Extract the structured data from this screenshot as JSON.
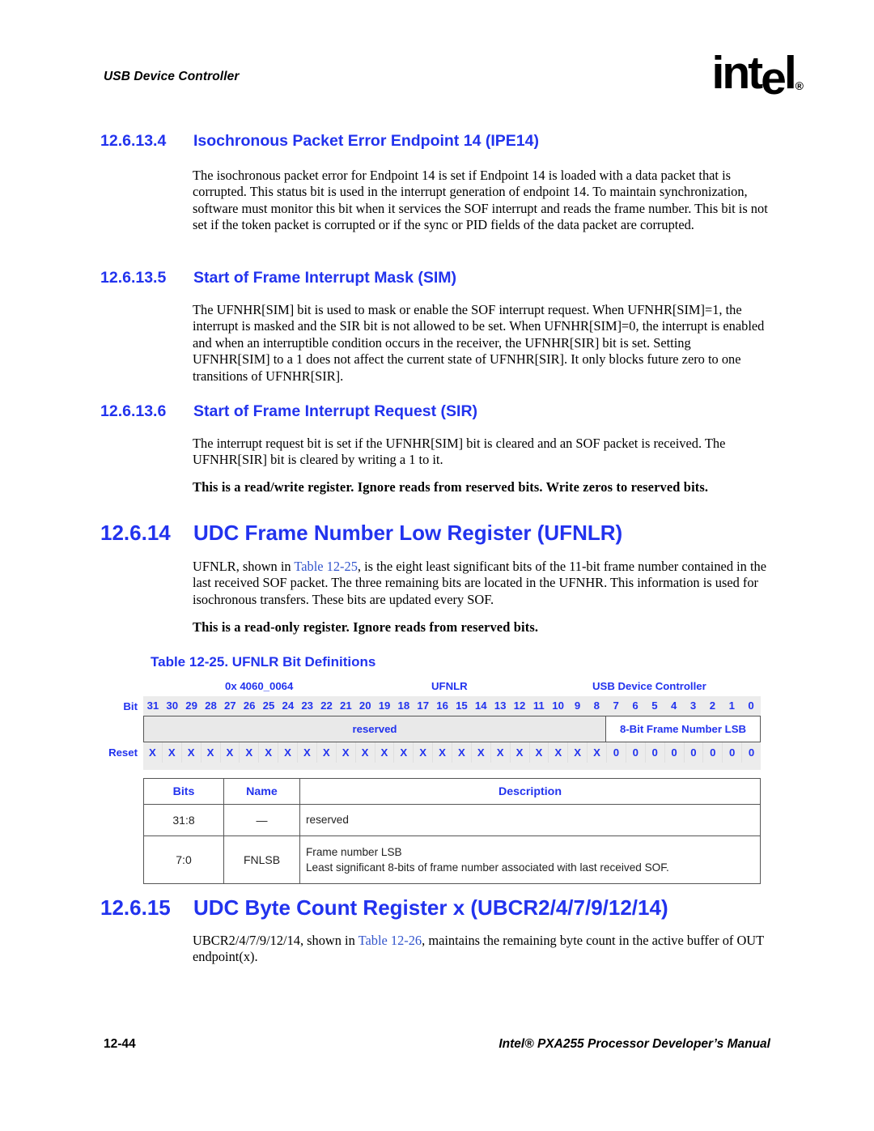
{
  "header": {
    "running_title": "USB Device Controller",
    "logo_text": "intel",
    "logo_registered": "®"
  },
  "sections": [
    {
      "number": "12.6.13.4",
      "title": "Isochronous Packet Error Endpoint 14 (IPE14)",
      "paragraph": "The isochronous packet error for Endpoint 14 is set if Endpoint 14 is loaded with a data packet that is corrupted. This status bit is used in the interrupt generation of endpoint 14. To maintain synchronization, software must monitor this bit when it services the SOF interrupt and reads the frame number. This bit is not set if the token packet is corrupted or if the sync or PID fields of the data packet are corrupted."
    },
    {
      "number": "12.6.13.5",
      "title": "Start of Frame Interrupt Mask (SIM)",
      "paragraph": "The UFNHR[SIM] bit is used to mask or enable the SOF interrupt request. When UFNHR[SIM]=1, the interrupt is masked and the SIR bit is not allowed to be set. When UFNHR[SIM]=0, the interrupt is enabled and when an interruptible condition occurs in the receiver, the UFNHR[SIR] bit is set. Setting UFNHR[SIM] to a 1 does not affect the current state of UFNHR[SIR]. It only blocks future zero to one transitions of UFNHR[SIR]."
    },
    {
      "number": "12.6.13.6",
      "title": "Start of Frame Interrupt Request (SIR)",
      "paragraph": "The interrupt request bit is set if the UFNHR[SIM] bit is cleared and an SOF packet is received. The UFNHR[SIR] bit is cleared by writing a 1 to it.",
      "note": "This is a read/write register. Ignore reads from reserved bits. Write zeros to reserved bits."
    }
  ],
  "ufnlr_section": {
    "number": "12.6.14",
    "title": "UDC Frame Number Low Register (UFNLR)",
    "para_pre": "UFNLR, shown in ",
    "para_xref": "Table 12-25",
    "para_post": ", is the eight least significant bits of the 11-bit frame number contained in the last received SOF packet. The three remaining bits are located in the UFNHR. This information is used for isochronous transfers. These bits are updated every SOF.",
    "note": "This is a read-only register. Ignore reads from reserved bits.",
    "table_caption": "Table 12-25. UFNLR Bit Definitions"
  },
  "register_diagram": {
    "address": "0x 4060_0064",
    "register_name": "UFNLR",
    "unit": "USB Device Controller",
    "bit_row_label": "Bit",
    "reset_row_label": "Reset",
    "bit_numbers": [
      "31",
      "30",
      "29",
      "28",
      "27",
      "26",
      "25",
      "24",
      "23",
      "22",
      "21",
      "20",
      "19",
      "18",
      "17",
      "16",
      "15",
      "14",
      "13",
      "12",
      "11",
      "10",
      "9",
      "8",
      "7",
      "6",
      "5",
      "4",
      "3",
      "2",
      "1",
      "0"
    ],
    "fields": [
      {
        "label": "reserved",
        "span": 24,
        "style": "reserved"
      },
      {
        "label": "8-Bit Frame Number LSB",
        "span": 8,
        "style": "named"
      }
    ],
    "reset_values": [
      "X",
      "X",
      "X",
      "X",
      "X",
      "X",
      "X",
      "X",
      "X",
      "X",
      "X",
      "X",
      "X",
      "X",
      "X",
      "X",
      "X",
      "X",
      "X",
      "X",
      "X",
      "X",
      "X",
      "X",
      "0",
      "0",
      "0",
      "0",
      "0",
      "0",
      "0",
      "0"
    ]
  },
  "definitions_table": {
    "columns": [
      "Bits",
      "Name",
      "Description"
    ],
    "rows": [
      {
        "bits": "31:8",
        "name": "—",
        "desc_line1": "reserved",
        "desc_line2": ""
      },
      {
        "bits": "7:0",
        "name": "FNLSB",
        "desc_line1": "Frame number LSB",
        "desc_line2": "Least significant 8-bits of frame number associated with last received SOF."
      }
    ]
  },
  "ubcr_section": {
    "number": "12.6.15",
    "title": "UDC Byte Count Register x (UBCR2/4/7/9/12/14)",
    "para_pre": "UBCR2/4/7/9/12/14, shown in ",
    "para_xref": "Table 12-26",
    "para_post": ", maintains the remaining byte count in the active buffer of OUT endpoint(x)."
  },
  "footer": {
    "page_number": "12-44",
    "document_title": "Intel® PXA255 Processor Developer’s Manual"
  }
}
